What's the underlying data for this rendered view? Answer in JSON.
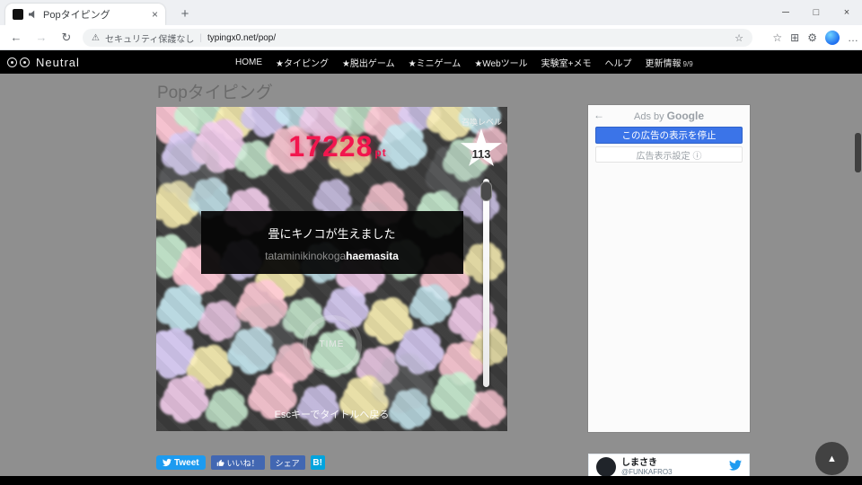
{
  "browser": {
    "tab_title": "Popタイピング",
    "tab_close_icon": "×",
    "new_tab_icon": "+",
    "back_icon": "←",
    "forward_icon": "→",
    "refresh_icon": "↻",
    "warning_icon": "⚠",
    "security_text": "セキュリティ保護なし",
    "url": "typingx0.net/pop/",
    "bookmark_star_icon": "☆",
    "favorites_icon": "☆",
    "collections_icon": "⊞",
    "settings_gear_icon": "⚙",
    "menu_icon": "…",
    "minimize_icon": "─",
    "maximize_icon": "□",
    "close_icon": "×"
  },
  "site_header": {
    "logo_text": "Neutral",
    "nav": [
      {
        "label": "HOME"
      },
      {
        "label": "★タイピング"
      },
      {
        "label": "★脱出ゲーム"
      },
      {
        "label": "★ミニゲーム"
      },
      {
        "label": "★Webツール"
      },
      {
        "label": "実験室+メモ"
      },
      {
        "label": "ヘルプ"
      },
      {
        "label": "更新情報"
      }
    ],
    "update_badge": "9/9"
  },
  "page": {
    "title": "Popタイピング"
  },
  "game": {
    "score": "17228",
    "score_unit": "pt",
    "level_label": "召喚レベル",
    "level_value": "113",
    "message_jp": "畳にキノコが生えました",
    "romaji_typed": "tataminikinokoga",
    "romaji_remaining": "haemasita",
    "time_label": "TIME",
    "esc_hint": "Escキーでタイトルへ戻る",
    "blob_palette": [
      "#ffc9d6",
      "#c9eed2",
      "#d9cdf6",
      "#fbf0b2",
      "#c6e9f2",
      "#f3cdec",
      "#dcedb6",
      "#aab0b6"
    ],
    "blobs": [
      [
        4,
        3,
        34,
        0,
        0.95
      ],
      [
        12,
        1,
        30,
        1,
        0.9
      ],
      [
        22,
        4,
        26,
        3,
        0.9
      ],
      [
        31,
        2,
        30,
        2,
        0.9
      ],
      [
        40,
        1,
        26,
        4,
        0.85
      ],
      [
        48,
        3,
        32,
        5,
        0.9
      ],
      [
        57,
        2,
        28,
        1,
        0.85
      ],
      [
        66,
        4,
        30,
        0,
        0.9
      ],
      [
        75,
        1,
        26,
        2,
        0.85
      ],
      [
        84,
        3,
        30,
        3,
        0.9
      ],
      [
        92,
        2,
        26,
        4,
        0.85
      ],
      [
        8,
        14,
        28,
        2,
        0.9
      ],
      [
        18,
        12,
        34,
        5,
        0.95
      ],
      [
        28,
        16,
        24,
        1,
        0.85
      ],
      [
        38,
        13,
        30,
        0,
        0.9
      ],
      [
        55,
        15,
        26,
        3,
        0.85
      ],
      [
        70,
        12,
        30,
        4,
        0.9
      ],
      [
        88,
        16,
        28,
        1,
        0.85
      ],
      [
        95,
        12,
        24,
        0,
        0.8
      ],
      [
        5,
        30,
        30,
        3,
        0.9
      ],
      [
        15,
        28,
        26,
        4,
        0.85
      ],
      [
        26,
        32,
        30,
        5,
        0.9
      ],
      [
        50,
        28,
        24,
        2,
        0.8
      ],
      [
        65,
        30,
        28,
        0,
        0.85
      ],
      [
        80,
        33,
        30,
        1,
        0.9
      ],
      [
        92,
        30,
        24,
        2,
        0.8
      ],
      [
        3,
        46,
        28,
        1,
        0.9
      ],
      [
        12,
        50,
        32,
        0,
        0.95
      ],
      [
        24,
        47,
        26,
        2,
        0.85
      ],
      [
        35,
        52,
        30,
        3,
        0.9
      ],
      [
        47,
        48,
        26,
        4,
        0.85
      ],
      [
        58,
        51,
        30,
        5,
        0.9
      ],
      [
        70,
        47,
        26,
        1,
        0.85
      ],
      [
        82,
        52,
        30,
        0,
        0.9
      ],
      [
        93,
        48,
        26,
        3,
        0.85
      ],
      [
        7,
        62,
        30,
        4,
        0.9
      ],
      [
        18,
        66,
        26,
        5,
        0.85
      ],
      [
        30,
        61,
        32,
        0,
        0.9
      ],
      [
        42,
        65,
        26,
        1,
        0.85
      ],
      [
        54,
        62,
        28,
        2,
        0.9
      ],
      [
        66,
        66,
        30,
        3,
        0.9
      ],
      [
        78,
        61,
        26,
        4,
        0.85
      ],
      [
        90,
        65,
        30,
        5,
        0.9
      ],
      [
        4,
        76,
        32,
        2,
        0.95
      ],
      [
        15,
        80,
        28,
        3,
        0.9
      ],
      [
        27,
        75,
        30,
        4,
        0.9
      ],
      [
        39,
        79,
        26,
        0,
        0.85
      ],
      [
        51,
        76,
        30,
        1,
        0.9
      ],
      [
        63,
        80,
        26,
        5,
        0.85
      ],
      [
        75,
        75,
        30,
        2,
        0.9
      ],
      [
        87,
        79,
        28,
        0,
        0.9
      ],
      [
        95,
        74,
        24,
        3,
        0.8
      ],
      [
        8,
        90,
        30,
        5,
        0.9
      ],
      [
        20,
        93,
        26,
        1,
        0.85
      ],
      [
        33,
        89,
        30,
        0,
        0.9
      ],
      [
        46,
        92,
        26,
        2,
        0.85
      ],
      [
        59,
        90,
        30,
        3,
        0.9
      ],
      [
        72,
        93,
        26,
        4,
        0.85
      ],
      [
        85,
        89,
        30,
        1,
        0.9
      ],
      [
        94,
        93,
        24,
        0,
        0.85
      ],
      [
        10,
        20,
        40,
        7,
        0.22
      ],
      [
        60,
        40,
        44,
        7,
        0.18
      ],
      [
        85,
        20,
        36,
        7,
        0.2
      ],
      [
        30,
        70,
        40,
        7,
        0.18
      ],
      [
        70,
        85,
        38,
        7,
        0.2
      ]
    ]
  },
  "share": {
    "tweet_label": "Tweet",
    "like_label": "いいね！",
    "share_label": "シェア",
    "hatena_label": "B!"
  },
  "ad": {
    "back_icon": "←",
    "header_prefix": "Ads by ",
    "brand": "Google",
    "stop_button": "この広告の表示を停止",
    "settings_label": "広告表示設定",
    "info_icon": "ⓘ"
  },
  "twitter_widget": {
    "name": "しまさき",
    "handle": "@FUNKAFRO3"
  },
  "misc": {
    "scroll_top_icon": "▲"
  }
}
